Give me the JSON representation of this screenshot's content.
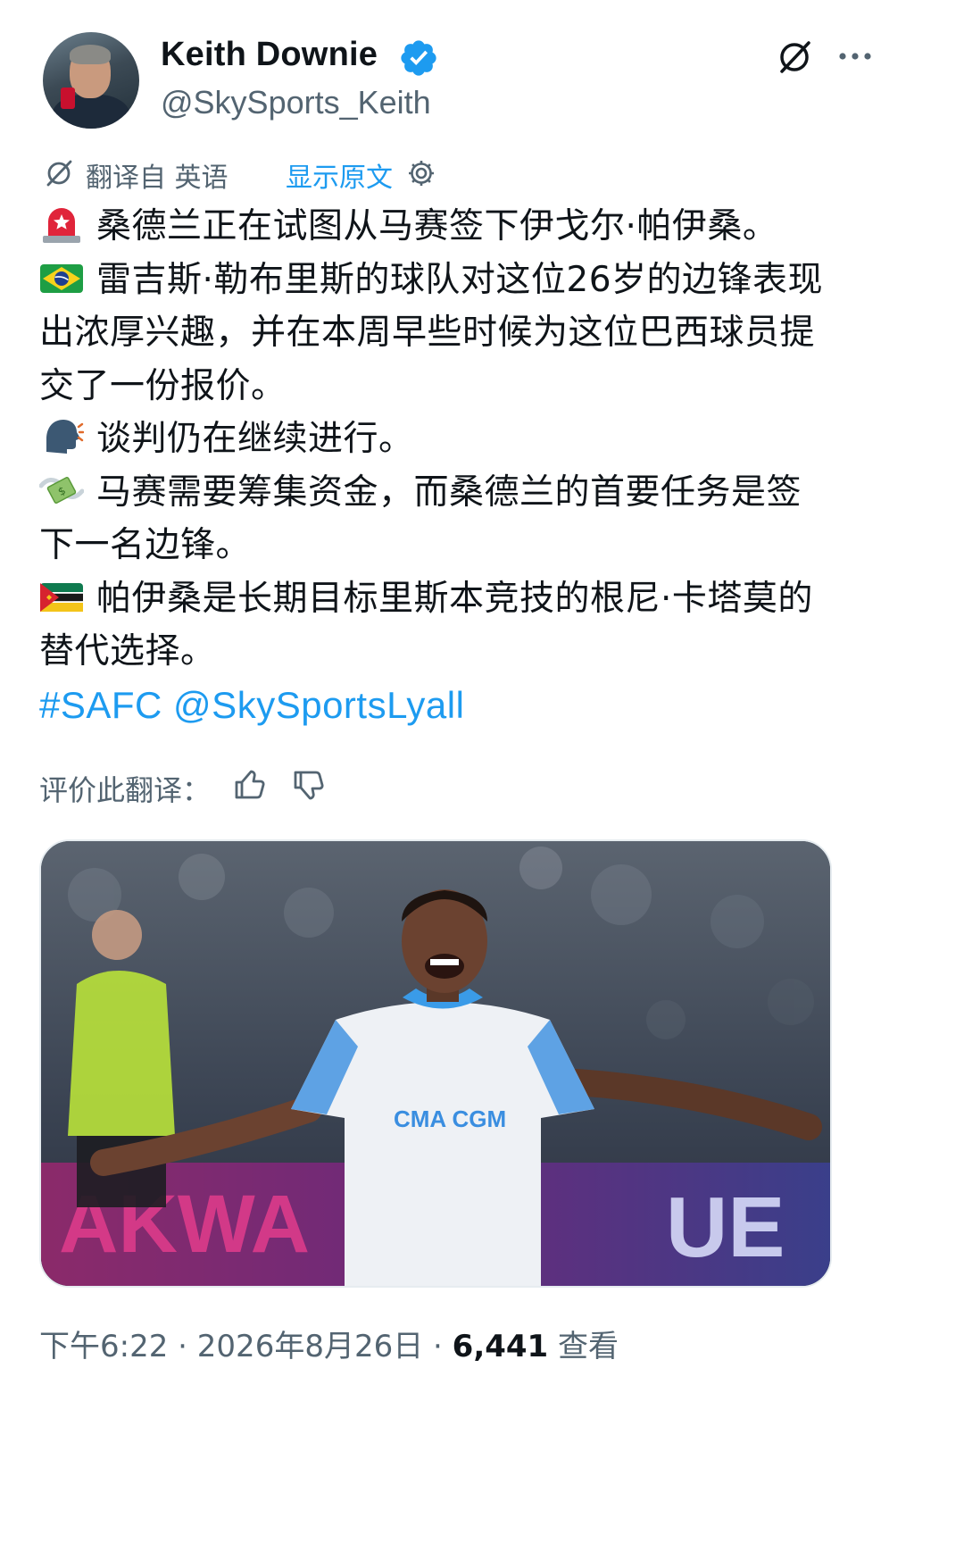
{
  "author": {
    "name": "Keith Downie",
    "handle": "@SkySports_Keith"
  },
  "translation": {
    "label": "翻译自 英语",
    "show_original": "显示原文"
  },
  "tweet": {
    "lines": [
      {
        "emoji": "siren-icon",
        "text": "桑德兰正在试图从马赛签下伊戈尔·帕伊桑。"
      },
      {
        "emoji": "brazil-flag-icon",
        "text": "雷吉斯·勒布里斯的球队对这位26岁的边锋表现出浓厚兴趣，并在本周早些时候为这位巴西球员提交了一份报价。"
      },
      {
        "emoji": "speaking-head-icon",
        "text": "谈判仍在继续进行。"
      },
      {
        "emoji": "money-wings-icon",
        "text": "马赛需要筹集资金，而桑德兰的首要任务是签下一名边锋。"
      },
      {
        "emoji": "mozambique-flag-icon",
        "text": "帕伊桑是长期目标里斯本竞技的根尼·卡塔莫的替代选择。"
      }
    ],
    "hashtag": "#SAFC",
    "mention": "@SkySportsLyall"
  },
  "rate": {
    "label": "评价此翻译："
  },
  "meta": {
    "time": "下午6:22",
    "date": "2026年8月26日",
    "views": "6,441",
    "views_label": "查看"
  },
  "colors": {
    "link": "#1d9bf0",
    "secondary": "#536471",
    "primary": "#0f1419",
    "verified": "#1d9bf0"
  }
}
